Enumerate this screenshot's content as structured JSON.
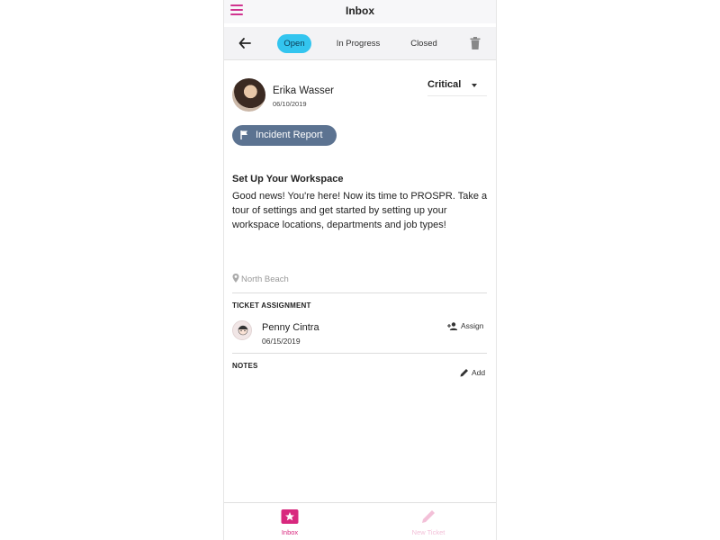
{
  "header": {
    "title": "Inbox"
  },
  "tabs": [
    {
      "label": "Open",
      "active": true
    },
    {
      "label": "In Progress",
      "active": false
    },
    {
      "label": "Closed",
      "active": false
    }
  ],
  "ticket": {
    "author_name": "Erika Wasser",
    "author_date": "06/10/2019",
    "priority": "Critical",
    "category": "Incident Report",
    "title": "Set Up Your Workspace",
    "body": "Good news! You're here! Now its time to PROSPR. Take a tour of settings and  get started by setting up your workspace locations, departments and job types!",
    "location": "North Beach"
  },
  "assignment": {
    "section_label": "TICKET ASSIGNMENT",
    "assignee_name": "Penny Cintra",
    "assignee_date": "06/15/2019",
    "action_label": "Assign"
  },
  "notes": {
    "section_label": "NOTES",
    "action_label": "Add"
  },
  "bottom_nav": {
    "inbox_label": "Inbox",
    "new_label": "New Ticket"
  },
  "colors": {
    "accent": "#d8287e",
    "active_tab": "#33c5ef",
    "badge": "#5c7391"
  },
  "icons": [
    "menu-icon",
    "back-arrow-icon",
    "trash-icon",
    "flag-icon",
    "location-pin-icon",
    "assign-user-icon",
    "pencil-icon",
    "inbox-icon"
  ]
}
